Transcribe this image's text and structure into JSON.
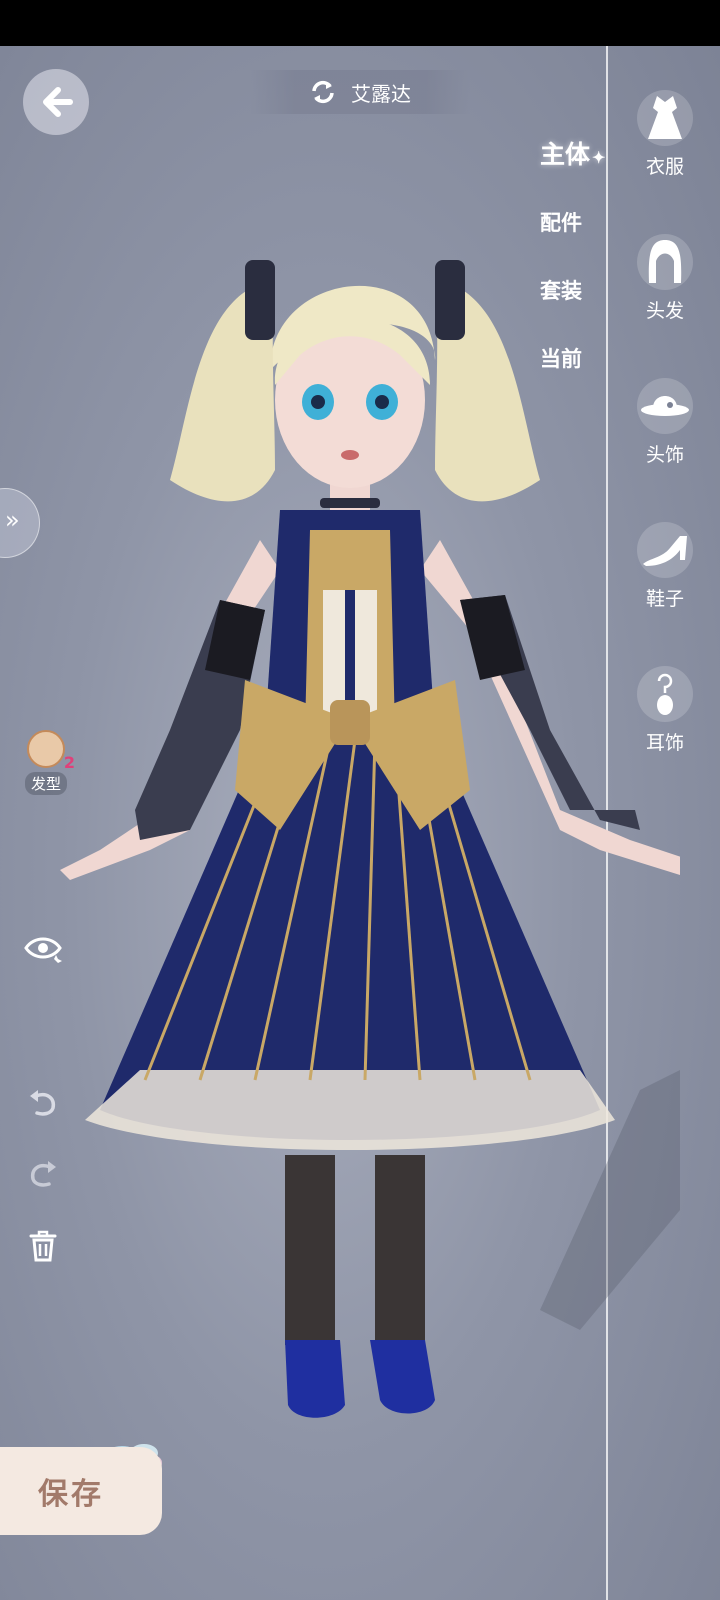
{
  "header": {
    "character_name": "艾露达"
  },
  "tabs": [
    {
      "label": "主体",
      "active": true
    },
    {
      "label": "配件",
      "active": false
    },
    {
      "label": "套装",
      "active": false
    },
    {
      "label": "当前",
      "active": false
    }
  ],
  "categories": [
    {
      "label": "衣服",
      "icon": "dress-icon"
    },
    {
      "label": "头发",
      "icon": "hair-icon"
    },
    {
      "label": "头饰",
      "icon": "hat-icon"
    },
    {
      "label": "鞋子",
      "icon": "shoe-icon"
    },
    {
      "label": "耳饰",
      "icon": "earring-icon"
    }
  ],
  "left_tools": {
    "hairstyle_label": "发型",
    "hairstyle_count": "2"
  },
  "save_label": "保存",
  "colors": {
    "dress_navy": "#1f2a6b",
    "dress_gold": "#c9a866",
    "hair_blonde": "#efe8c6"
  }
}
